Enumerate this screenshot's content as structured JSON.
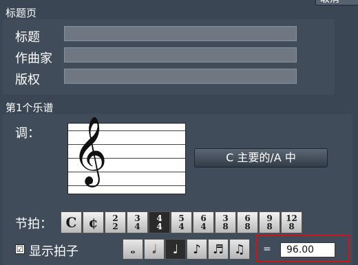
{
  "header": {
    "cancel_label": "取消"
  },
  "title_page": {
    "section_title": "标题页",
    "fields": [
      {
        "label": "标题",
        "value": ""
      },
      {
        "label": "作曲家",
        "value": ""
      },
      {
        "label": "版权",
        "value": ""
      }
    ]
  },
  "score": {
    "section_title": "第1个乐谱",
    "key_label": "调：",
    "key_value": "C 主要的/A 中",
    "time_label": "节拍：",
    "time_signatures": [
      {
        "top": "",
        "bottom": "",
        "symbol": "C",
        "selected": false
      },
      {
        "top": "",
        "bottom": "",
        "symbol": "¢",
        "selected": false
      },
      {
        "top": "2",
        "bottom": "2",
        "symbol": "",
        "selected": false
      },
      {
        "top": "3",
        "bottom": "4",
        "symbol": "",
        "selected": false
      },
      {
        "top": "4",
        "bottom": "4",
        "symbol": "",
        "selected": true
      },
      {
        "top": "5",
        "bottom": "4",
        "symbol": "",
        "selected": false
      },
      {
        "top": "6",
        "bottom": "4",
        "symbol": "",
        "selected": false
      },
      {
        "top": "3",
        "bottom": "8",
        "symbol": "",
        "selected": false
      },
      {
        "top": "6",
        "bottom": "8",
        "symbol": "",
        "selected": false
      },
      {
        "top": "9",
        "bottom": "8",
        "symbol": "",
        "selected": false
      },
      {
        "top": "12",
        "bottom": "8",
        "symbol": "",
        "selected": false
      }
    ],
    "show_beats_label": "显示拍子",
    "show_beats_checked": true,
    "checkmark": "☑",
    "tempo_equals": "=",
    "tempo_value": "96.00"
  }
}
